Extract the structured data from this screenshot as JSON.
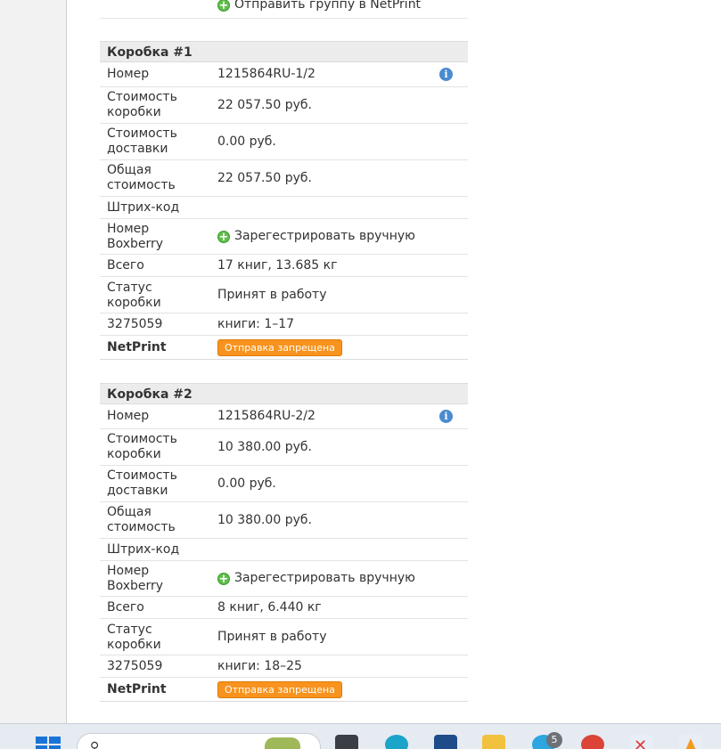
{
  "send_group_label": "Отправить группу в NetPrint",
  "boxes": [
    {
      "title": "Коробка #1",
      "rows": [
        {
          "label": "Номер",
          "value": "1215864RU-1/2"
        },
        {
          "label": "Стоимость коробки",
          "value": "22 057.50 руб."
        },
        {
          "label": "Стоимость доставки",
          "value": "0.00 руб."
        },
        {
          "label": "Общая стоимость",
          "value": "22 057.50 руб."
        },
        {
          "label": "Штрих-код",
          "value": ""
        },
        {
          "label": "Номер Boxberry",
          "value": "Зарегестрировать вручную"
        },
        {
          "label": "Всего",
          "value": "17 книг, 13.685 кг"
        },
        {
          "label": "Статус коробки",
          "value": "Принят в работу"
        },
        {
          "label": "3275059",
          "value": "книги: 1–17"
        },
        {
          "label": "NetPrint",
          "value": "Отправка запрещена"
        }
      ]
    },
    {
      "title": "Коробка #2",
      "rows": [
        {
          "label": "Номер",
          "value": "1215864RU-2/2"
        },
        {
          "label": "Стоимость коробки",
          "value": "10 380.00 руб."
        },
        {
          "label": "Стоимость доставки",
          "value": "0.00 руб."
        },
        {
          "label": "Общая стоимость",
          "value": "10 380.00 руб."
        },
        {
          "label": "Штрих-код",
          "value": ""
        },
        {
          "label": "Номер Boxberry",
          "value": "Зарегестрировать вручную"
        },
        {
          "label": "Всего",
          "value": "8 книг, 6.440 кг"
        },
        {
          "label": "Статус коробки",
          "value": "Принят в работу"
        },
        {
          "label": "3275059",
          "value": "книги: 18–25"
        },
        {
          "label": "NetPrint",
          "value": "Отправка запрещена"
        }
      ]
    }
  ],
  "icons": {
    "info": "info-icon",
    "add": "plus-circle-icon"
  },
  "colors": {
    "badge": "#f7931e",
    "add_icon": "#5fbf4a",
    "info_icon": "#4b8bd0"
  },
  "taskbar": {
    "search_icon": "search-icon",
    "notification_count": "5"
  }
}
